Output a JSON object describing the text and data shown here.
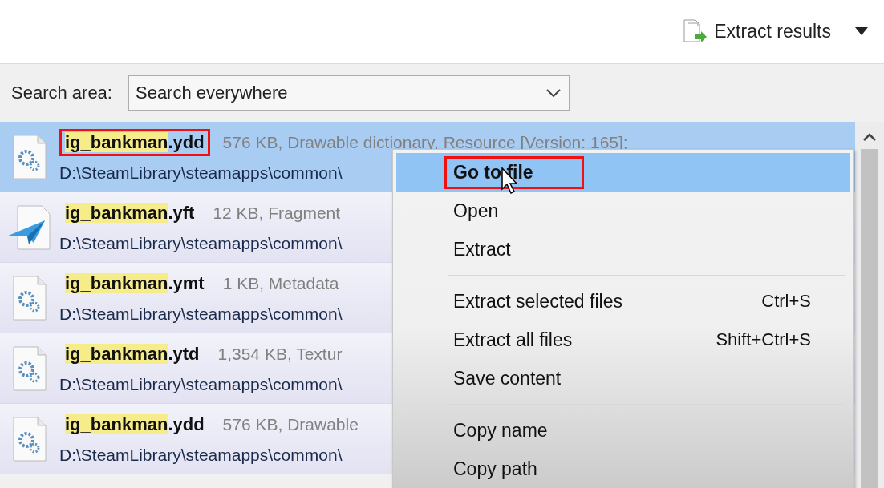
{
  "toolbar": {
    "extract_button": "Extract results"
  },
  "search_area": {
    "label": "Search area:",
    "value": "Search everywhere"
  },
  "results": [
    {
      "match": "ig_bankman",
      "ext": ".ydd",
      "details": "576 KB, Drawable dictionary, Resource [Version: 165];",
      "path": "D:\\SteamLibrary\\steamapps\\common\\",
      "kind": "gear",
      "selected": true,
      "annotated": true
    },
    {
      "match": "ig_bankman",
      "ext": ".yft",
      "details": "12 KB, Fragment",
      "path": "D:\\SteamLibrary\\steamapps\\common\\",
      "kind": "plane",
      "selected": false,
      "annotated": false
    },
    {
      "match": "ig_bankman",
      "ext": ".ymt",
      "details": "1 KB, Metadata",
      "path": "D:\\SteamLibrary\\steamapps\\common\\",
      "kind": "gear",
      "selected": false,
      "annotated": false
    },
    {
      "match": "ig_bankman",
      "ext": ".ytd",
      "details": "1,354 KB, Textur",
      "path": "D:\\SteamLibrary\\steamapps\\common\\",
      "kind": "gear",
      "selected": false,
      "annotated": false
    },
    {
      "match": "ig_bankman",
      "ext": ".ydd",
      "details": "576 KB, Drawable",
      "path": "D:\\SteamLibrary\\steamapps\\common\\",
      "kind": "gear",
      "selected": false,
      "annotated": false
    }
  ],
  "context_menu": {
    "groups": [
      [
        {
          "label": "Go to file",
          "bold": true,
          "selected": true,
          "annotated": true
        },
        {
          "label": "Open",
          "bold": false,
          "selected": false,
          "annotated": false
        },
        {
          "label": "Extract",
          "bold": false,
          "selected": false,
          "annotated": false
        }
      ],
      [
        {
          "label": "Extract selected files",
          "shortcut": "Ctrl+S",
          "bold": false,
          "selected": false,
          "annotated": false
        },
        {
          "label": "Extract all files",
          "shortcut": "Shift+Ctrl+S",
          "bold": false,
          "selected": false,
          "annotated": false
        },
        {
          "label": "Save content",
          "bold": false,
          "selected": false,
          "annotated": false
        }
      ],
      [
        {
          "label": "Copy name",
          "bold": false,
          "selected": false,
          "annotated": false
        },
        {
          "label": "Copy path",
          "bold": false,
          "selected": false,
          "annotated": false
        }
      ]
    ]
  }
}
